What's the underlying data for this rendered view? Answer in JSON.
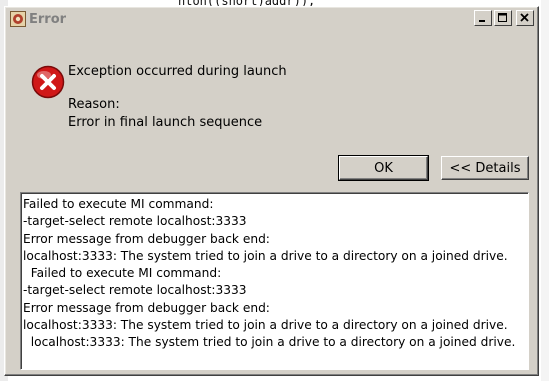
{
  "background": {
    "top_text": "hton((short)addr));"
  },
  "dialog": {
    "title": "Error",
    "icons": {
      "app": "eclipse-app-icon",
      "error": "error-icon"
    },
    "titlebar_buttons": [
      "minimize",
      "maximize",
      "close"
    ],
    "message": "Exception occurred during launch",
    "reason_label": "Reason:",
    "reason_text": "Error in final launch sequence",
    "buttons": {
      "ok": "OK",
      "details": "<< Details"
    },
    "details": [
      "Failed to execute MI command:",
      "-target-select remote localhost:3333",
      "Error message from debugger back end:",
      "localhost:3333: The system tried to join a drive to a directory on a joined drive.",
      "  Failed to execute MI command:",
      "-target-select remote localhost:3333",
      "Error message from debugger back end:",
      "localhost:3333: The system tried to join a drive to a directory on a joined drive.",
      "  localhost:3333: The system tried to join a drive to a directory on a joined drive."
    ]
  },
  "colors": {
    "dialog_bg": "#d4d0c8",
    "error_red": "#d01818",
    "title_text": "#808080"
  }
}
